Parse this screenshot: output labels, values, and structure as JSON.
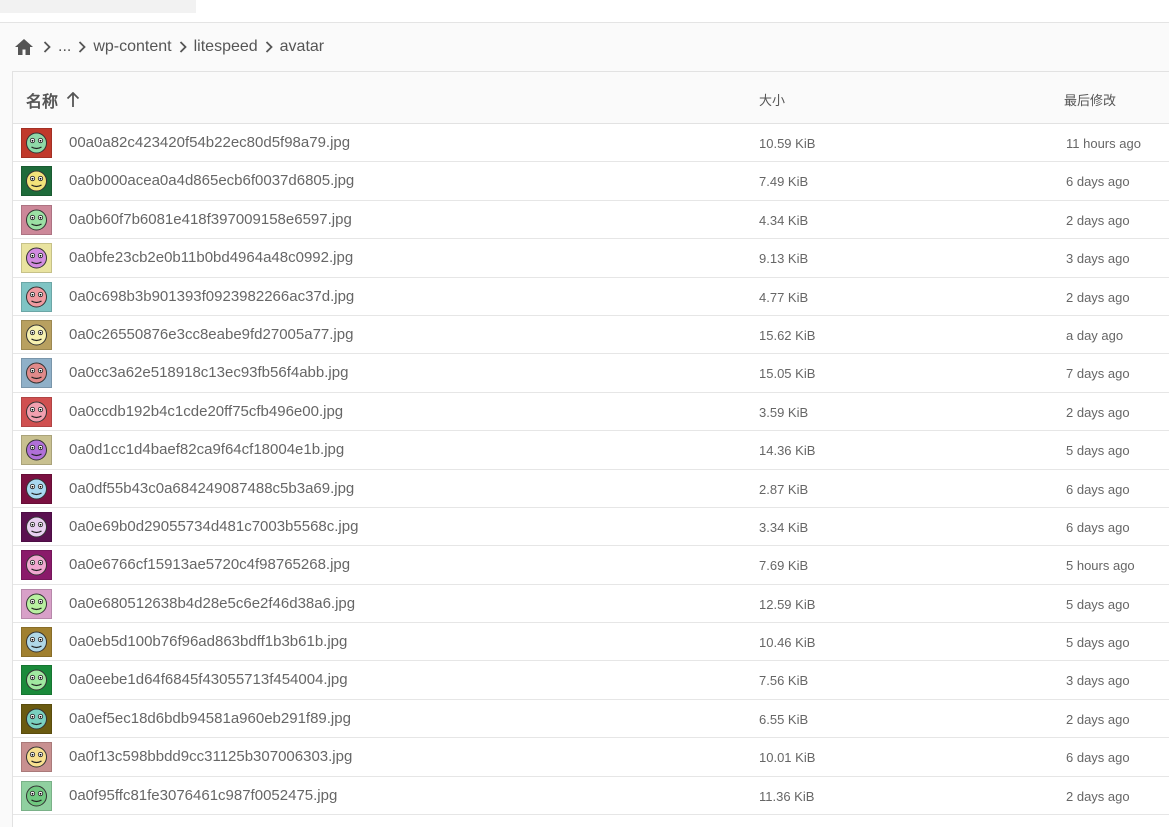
{
  "breadcrumb": {
    "home_icon": "home-icon",
    "items": [
      "...",
      "wp-content",
      "litespeed",
      "avatar"
    ]
  },
  "table": {
    "columns": {
      "name": "名称",
      "size": "大小",
      "modified": "最后修改"
    },
    "sort_icon": "arrow-up-icon",
    "rows": [
      {
        "name": "00a0a82c423420f54b22ec80d5f98a79.jpg",
        "size": "10.59 KiB",
        "modified": "11 hours ago",
        "thumb_bg": "#c0392b",
        "thumb_face": "#8fd9a8"
      },
      {
        "name": "0a0b000acea0a4d865ecb6f0037d6805.jpg",
        "size": "7.49 KiB",
        "modified": "6 days ago",
        "thumb_bg": "#1e6b3a",
        "thumb_face": "#f3e37a"
      },
      {
        "name": "0a0b60f7b6081e418f397009158e6597.jpg",
        "size": "4.34 KiB",
        "modified": "2 days ago",
        "thumb_bg": "#cc8899",
        "thumb_face": "#9be0a4"
      },
      {
        "name": "0a0bfe23cb2e0b11b0bd4964a48c0992.jpg",
        "size": "9.13 KiB",
        "modified": "3 days ago",
        "thumb_bg": "#e9e3a0",
        "thumb_face": "#d28be0"
      },
      {
        "name": "0a0c698b3b901393f0923982266ac37d.jpg",
        "size": "4.77 KiB",
        "modified": "2 days ago",
        "thumb_bg": "#7fc4c4",
        "thumb_face": "#f09aa0"
      },
      {
        "name": "0a0c26550876e3cc8eabe9fd27005a77.jpg",
        "size": "15.62 KiB",
        "modified": "a day ago",
        "thumb_bg": "#b8a060",
        "thumb_face": "#f6f0b0"
      },
      {
        "name": "0a0cc3a62e518918c13ec93fb56f4abb.jpg",
        "size": "15.05 KiB",
        "modified": "7 days ago",
        "thumb_bg": "#8fb0c8",
        "thumb_face": "#e08a8a"
      },
      {
        "name": "0a0ccdb192b4c1cde20ff75cfb496e00.jpg",
        "size": "3.59 KiB",
        "modified": "2 days ago",
        "thumb_bg": "#d05050",
        "thumb_face": "#f2a0b0"
      },
      {
        "name": "0a0d1cc1d4baef82ca9f64cf18004e1b.jpg",
        "size": "14.36 KiB",
        "modified": "5 days ago",
        "thumb_bg": "#c8c090",
        "thumb_face": "#b070d8"
      },
      {
        "name": "0a0df55b43c0a684249087488c5b3a69.jpg",
        "size": "2.87 KiB",
        "modified": "6 days ago",
        "thumb_bg": "#7a1040",
        "thumb_face": "#a8d8f0"
      },
      {
        "name": "0a0e69b0d29055734d481c7003b5568c.jpg",
        "size": "3.34 KiB",
        "modified": "6 days ago",
        "thumb_bg": "#5a1050",
        "thumb_face": "#e8d0f0"
      },
      {
        "name": "0a0e6766cf15913ae5720c4f98765268.jpg",
        "size": "7.69 KiB",
        "modified": "5 hours ago",
        "thumb_bg": "#8a1a6a",
        "thumb_face": "#f0a8d0"
      },
      {
        "name": "0a0e680512638b4d28e5c6e2f46d38a6.jpg",
        "size": "12.59 KiB",
        "modified": "5 days ago",
        "thumb_bg": "#d8a0c8",
        "thumb_face": "#b8f0a0"
      },
      {
        "name": "0a0eb5d100b76f96ad863bdff1b3b61b.jpg",
        "size": "10.46 KiB",
        "modified": "5 days ago",
        "thumb_bg": "#a08030",
        "thumb_face": "#b0d8e8"
      },
      {
        "name": "0a0eebe1d64f6845f43055713f454004.jpg",
        "size": "7.56 KiB",
        "modified": "3 days ago",
        "thumb_bg": "#1a8a3a",
        "thumb_face": "#a0e8a0"
      },
      {
        "name": "0a0ef5ec18d6bdb94581a960eb291f89.jpg",
        "size": "6.55 KiB",
        "modified": "2 days ago",
        "thumb_bg": "#6a5a10",
        "thumb_face": "#7ad0c0"
      },
      {
        "name": "0a0f13c598bbdd9cc31125b307006303.jpg",
        "size": "10.01 KiB",
        "modified": "6 days ago",
        "thumb_bg": "#c89090",
        "thumb_face": "#f8e090"
      },
      {
        "name": "0a0f95ffc81fe3076461c987f0052475.jpg",
        "size": "11.36 KiB",
        "modified": "2 days ago",
        "thumb_bg": "#90d0a0",
        "thumb_face": "#70c880"
      }
    ]
  }
}
